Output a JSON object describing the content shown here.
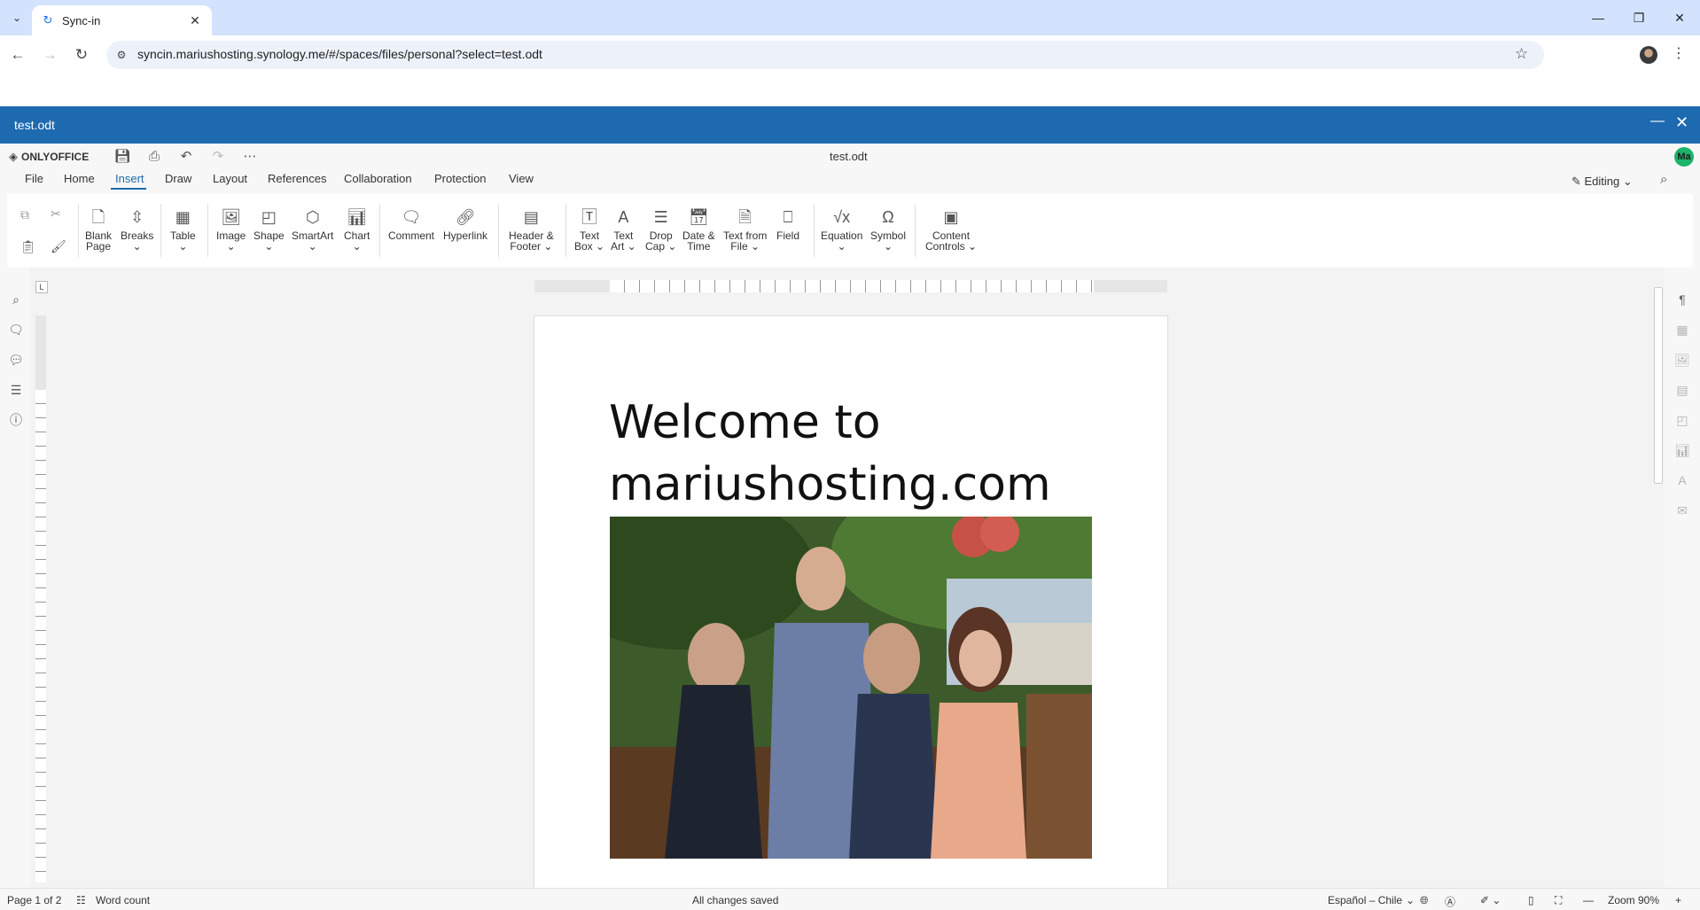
{
  "browser": {
    "tab_title": "Sync-in",
    "url": "syncin.mariushosting.synology.me/#/spaces/files/personal?select=test.odt"
  },
  "viewer": {
    "title": "test.odt"
  },
  "editor": {
    "brand": "ONLYOFFICE",
    "doc_title": "test.odt",
    "user_initials": "Ma",
    "mode": "Editing",
    "menu": [
      "File",
      "Home",
      "Insert",
      "Draw",
      "Layout",
      "References",
      "Collaboration",
      "Protection",
      "View"
    ],
    "active_menu": "Insert",
    "ribbon": {
      "blank_page": [
        "Blank",
        "Page"
      ],
      "breaks": [
        "Breaks",
        "⌄"
      ],
      "table": [
        "Table",
        "⌄"
      ],
      "image": [
        "Image",
        "⌄"
      ],
      "shape": [
        "Shape",
        "⌄"
      ],
      "smartart": [
        "SmartArt",
        "⌄"
      ],
      "chart": [
        "Chart",
        "⌄"
      ],
      "comment": [
        "Comment"
      ],
      "hyperlink": [
        "Hyperlink"
      ],
      "header_footer": [
        "Header &",
        "Footer ⌄"
      ],
      "text_box": [
        "Text",
        "Box ⌄"
      ],
      "text_art": [
        "Text",
        "Art ⌄"
      ],
      "drop_cap": [
        "Drop",
        "Cap ⌄"
      ],
      "date_time": [
        "Date &",
        "Time"
      ],
      "text_from_file": [
        "Text from",
        "File ⌄"
      ],
      "field": [
        "Field"
      ],
      "equation": [
        "Equation",
        "⌄"
      ],
      "symbol": [
        "Symbol",
        "⌄"
      ],
      "content_controls": [
        "Content",
        "Controls ⌄"
      ]
    },
    "document": {
      "heading_line1": "Welcome to",
      "heading_line2": "mariushosting.com"
    },
    "status": {
      "page": "Page 1 of 2",
      "word_count": "Word count",
      "saved": "All changes saved",
      "language": "Español – Chile",
      "zoom": "Zoom 90%"
    }
  },
  "colors": {
    "accent": "#1d6ab0",
    "tab_strip": "#d3e3fd",
    "avatar": "#1cb36b"
  }
}
